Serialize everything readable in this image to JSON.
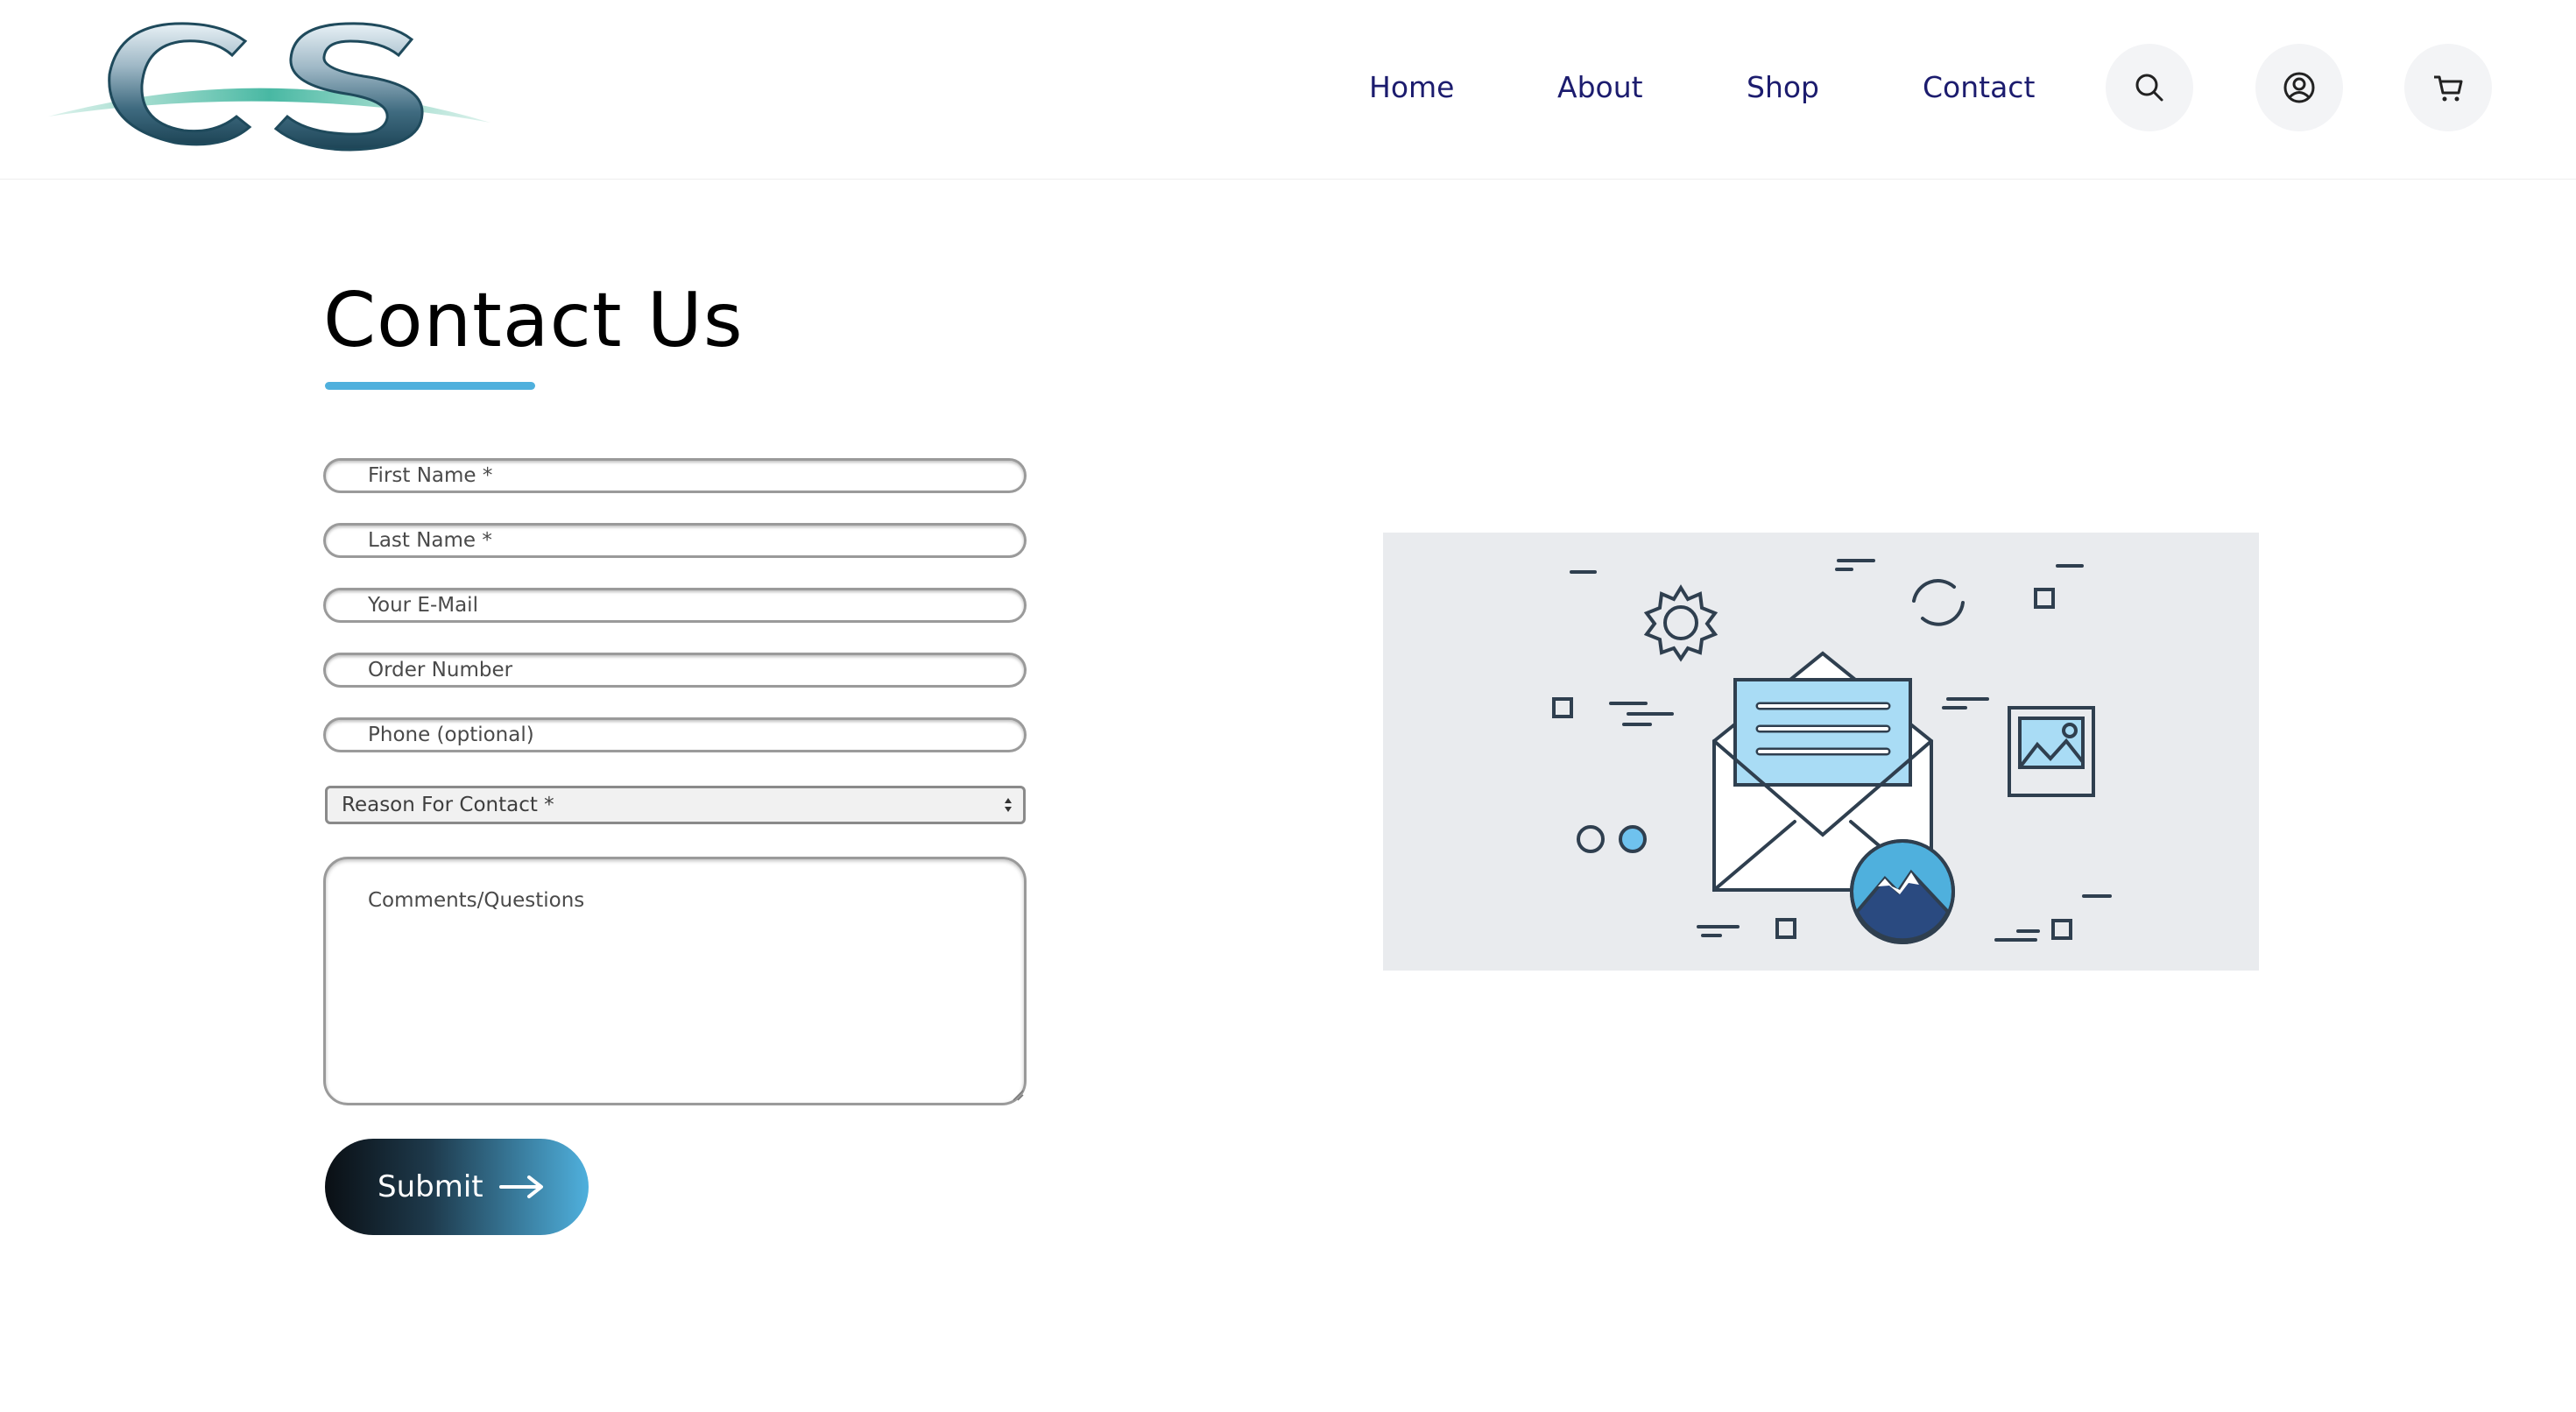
{
  "header": {
    "logo_alt": "CS",
    "nav": [
      {
        "label": "Home"
      },
      {
        "label": "About"
      },
      {
        "label": "Shop"
      },
      {
        "label": "Contact"
      }
    ],
    "icons": [
      "search-icon",
      "account-icon",
      "cart-icon"
    ]
  },
  "page": {
    "title": "Contact Us"
  },
  "form": {
    "first_name_placeholder": "First Name *",
    "last_name_placeholder": "Last Name *",
    "email_placeholder": "Your E-Mail",
    "order_number_placeholder": "Order Number",
    "phone_placeholder": "Phone (optional)",
    "reason_selected": "Reason For Contact *",
    "comments_placeholder": "Comments/Questions",
    "submit_label": "Submit"
  },
  "colors": {
    "nav_text": "#1c1c6e",
    "accent": "#4fb0dd",
    "illustration_bg": "#e9ebee"
  }
}
